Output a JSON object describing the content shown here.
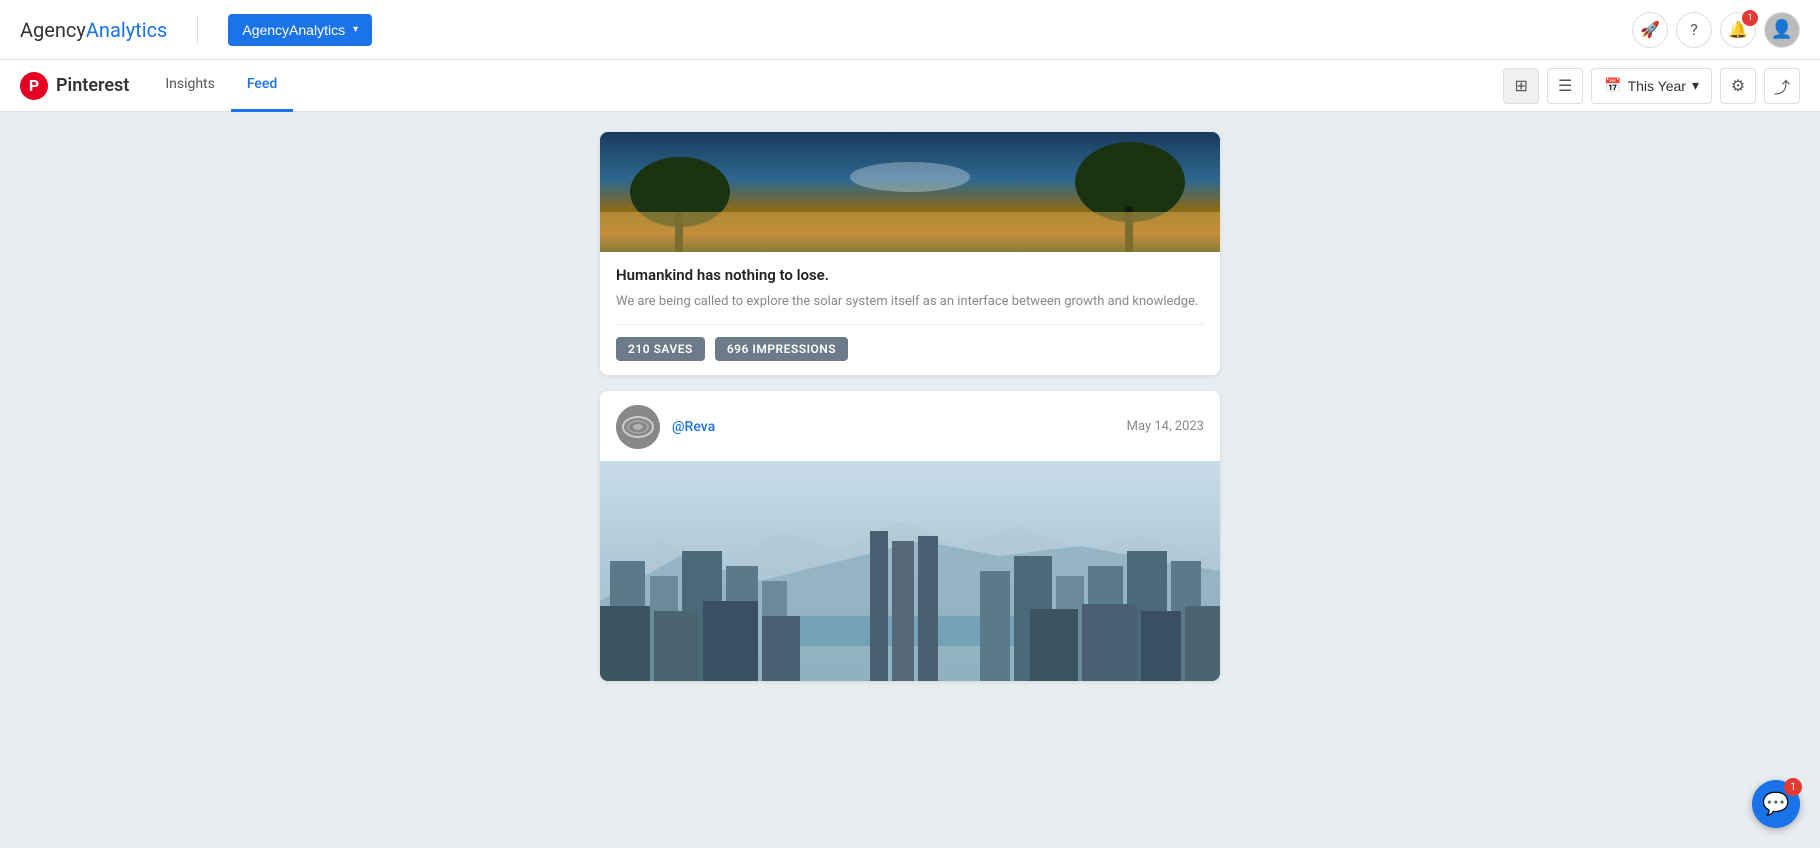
{
  "app": {
    "brand_agency": "Agency",
    "brand_analytics": "Analytics",
    "dropdown_label": "AgencyAnalytics",
    "dropdown_chevron": "▾"
  },
  "nav_icons": {
    "rocket_label": "🚀",
    "help_label": "?",
    "bell_label": "🔔",
    "bell_badge": "1"
  },
  "sub_nav": {
    "platform_icon": "P",
    "platform_name": "Pinterest",
    "tabs": [
      {
        "id": "insights",
        "label": "Insights"
      },
      {
        "id": "feed",
        "label": "Feed"
      }
    ],
    "active_tab": "feed",
    "date_filter_icon": "📅",
    "date_filter_label": "This Year",
    "date_filter_chevron": "▾"
  },
  "post1": {
    "title": "Humankind has nothing to lose.",
    "description": "We are being called to explore the solar system itself as an interface between growth and knowledge.",
    "stat1_count": "210",
    "stat1_label": "SAVES",
    "stat2_count": "696",
    "stat2_label": "IMPRESSIONS"
  },
  "post2": {
    "username": "@Reva",
    "date": "May 14, 2023"
  },
  "chat": {
    "badge": "1"
  }
}
